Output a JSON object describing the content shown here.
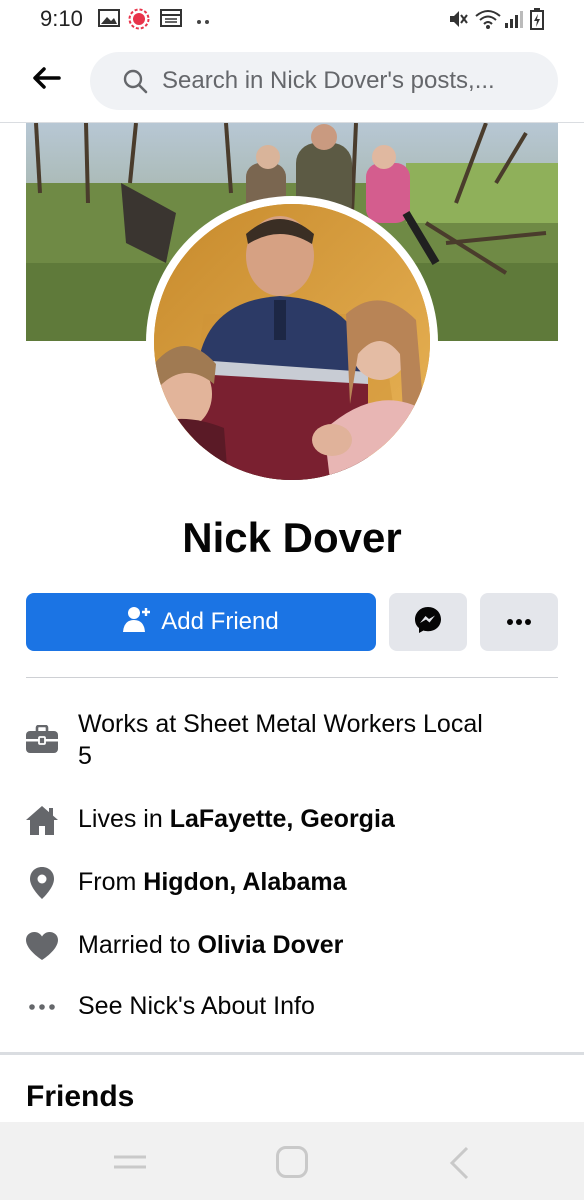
{
  "status_bar": {
    "time": "9:10"
  },
  "search": {
    "placeholder": "Search in Nick Dover's posts,..."
  },
  "profile": {
    "name": "Nick Dover"
  },
  "actions": {
    "add_friend_label": "Add Friend"
  },
  "intro": {
    "work": {
      "line1": "Works at Sheet Metal Workers Local",
      "line2": "5",
      "icon": "briefcase-icon"
    },
    "lives": {
      "prefix": "Lives in ",
      "place": "LaFayette, Georgia",
      "icon": "home-icon"
    },
    "from": {
      "prefix": "From ",
      "place": "Higdon, Alabama",
      "icon": "location-pin-icon"
    },
    "married": {
      "prefix": "Married to ",
      "spouse": "Olivia Dover",
      "icon": "heart-icon"
    },
    "about": {
      "label": "See Nick's About Info",
      "icon": "more-dots-icon"
    }
  },
  "friends": {
    "title": "Friends"
  },
  "colors": {
    "accent": "#1b74e4",
    "icon_gray": "#65676b",
    "button_gray": "#e4e6eb"
  }
}
